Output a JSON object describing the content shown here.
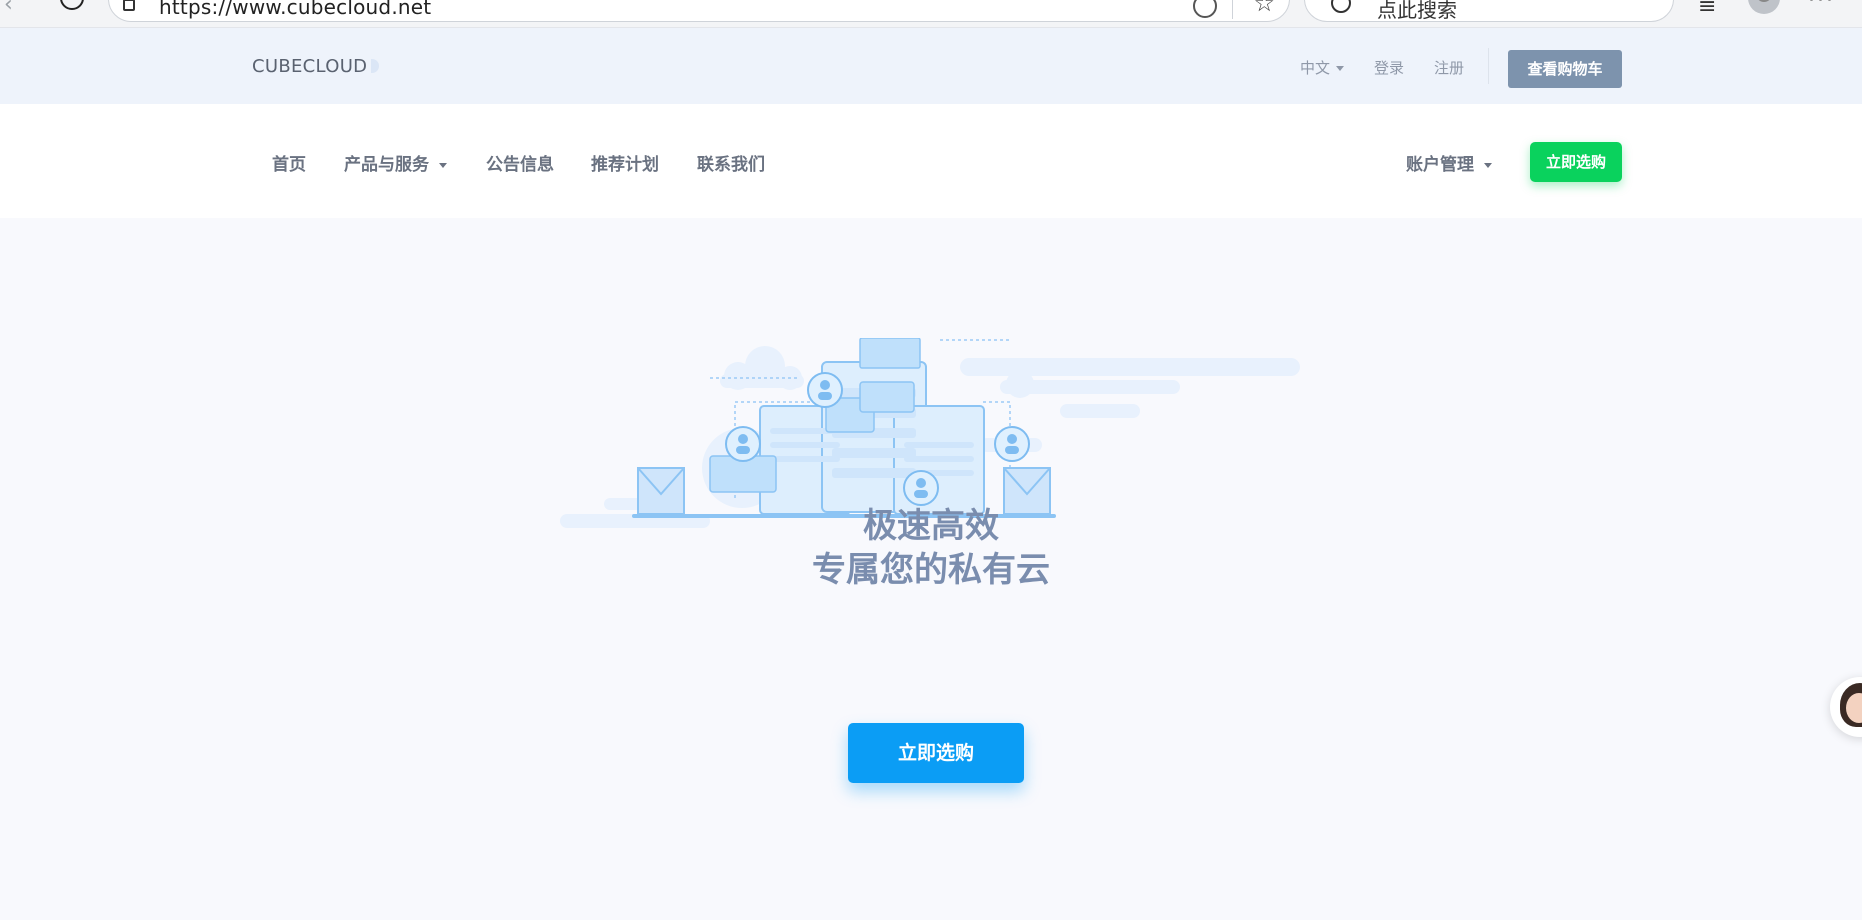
{
  "browser": {
    "url": "https://www.cubecloud.net",
    "search_placeholder": "点此搜索"
  },
  "topbar": {
    "logo": "CUBECLOUD",
    "language": "中文",
    "login": "登录",
    "register": "注册",
    "cart_button": "查看购物车"
  },
  "nav": {
    "items": [
      {
        "label": "首页"
      },
      {
        "label": "产品与服务"
      },
      {
        "label": "公告信息"
      },
      {
        "label": "推荐计划"
      },
      {
        "label": "联系我们"
      }
    ],
    "account": "账户管理",
    "buy_button": "立即选购"
  },
  "hero": {
    "title_line1": "极速高效",
    "title_line2": "专属您的私有云",
    "cta": "立即选购"
  },
  "colors": {
    "accent_green": "#0ad25d",
    "accent_blue": "#0b9df5",
    "cart_gray": "#7d93ad",
    "hero_text": "#7a8dae"
  },
  "icons": {
    "back": "back-arrow-icon",
    "reload": "reload-icon",
    "lock": "lock-icon",
    "star": "star-icon",
    "search": "search-icon",
    "collections": "collections-icon",
    "profile": "profile-icon",
    "more": "more-icon",
    "support": "support-avatar-icon"
  }
}
